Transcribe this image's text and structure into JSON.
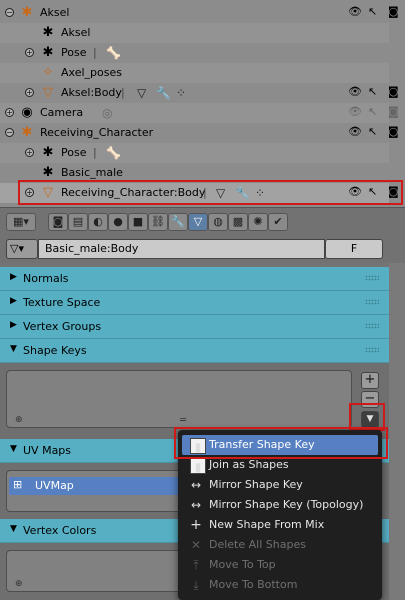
{
  "outliner": {
    "rows": [
      {
        "label": "Aksel"
      },
      {
        "label": "Aksel"
      },
      {
        "label": "Pose"
      },
      {
        "label": "Axel_poses"
      },
      {
        "label": "Aksel:Body"
      },
      {
        "label": "Camera"
      },
      {
        "label": "Receiving_Character"
      },
      {
        "label": "Pose"
      },
      {
        "label": "Basic_male"
      },
      {
        "label": "Receiving_Character:Body"
      }
    ]
  },
  "properties": {
    "context_object": "Basic_male:Body",
    "fake_user": "F",
    "panels": {
      "normals": "Normals",
      "texture_space": "Texture Space",
      "vertex_groups": "Vertex Groups",
      "shape_keys": "Shape Keys",
      "uv_maps": "UV Maps",
      "vertex_colors": "Vertex Colors"
    },
    "uv_map_item": "UVMap",
    "add_symbol": "+",
    "remove_symbol": "−"
  },
  "shape_key_menu": {
    "items": [
      {
        "label": "Transfer Shape Key",
        "icon": "transfer-shape-key-icon",
        "state": "highlighted"
      },
      {
        "label": "Join as Shapes",
        "icon": "join-shapes-icon",
        "state": "enabled"
      },
      {
        "label": "Mirror Shape Key",
        "icon": "mirror-icon",
        "state": "enabled"
      },
      {
        "label": "Mirror Shape Key (Topology)",
        "icon": "mirror-icon",
        "state": "enabled"
      },
      {
        "label": "New Shape From Mix",
        "icon": "plus-icon",
        "state": "enabled"
      },
      {
        "label": "Delete All Shapes",
        "icon": "x-icon",
        "state": "disabled"
      },
      {
        "label": "Move To Top",
        "icon": "move-top-icon",
        "state": "disabled"
      },
      {
        "label": "Move To Bottom",
        "icon": "move-bottom-icon",
        "state": "disabled"
      }
    ]
  },
  "colors": {
    "panel_header": "#56afc3",
    "highlight": "#5680c2",
    "annotation_red": "#d01a1a",
    "object_orange": "#c86a1c"
  }
}
